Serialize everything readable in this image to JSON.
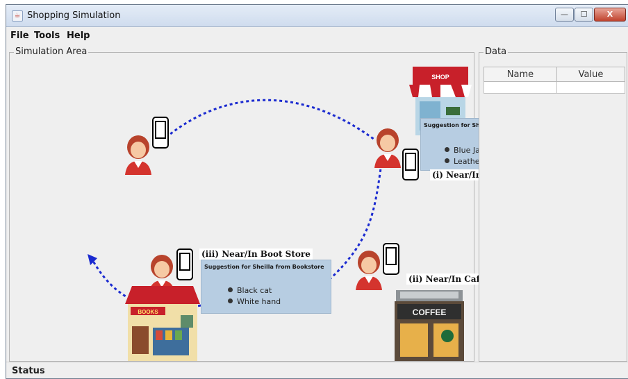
{
  "window": {
    "title": "Shopping Simulation",
    "controls": {
      "minimize": "—",
      "maximize": "☐",
      "close": "X"
    }
  },
  "menu": {
    "items": [
      "File",
      "Tools",
      "Help"
    ]
  },
  "simulation_panel": {
    "label": "Simulation Area",
    "shop_sign": "SHOP",
    "cafe_sign": "COFFEE",
    "bookstore_sign": "BOOKS",
    "locations": [
      {
        "label": "(i) Near/In Shop"
      },
      {
        "label": "(ii) Near/In Cafe"
      },
      {
        "label": "(iii) Near/In Boot Store"
      }
    ],
    "suggestions": [
      {
        "title": "Suggestion for Sheillafrom Fashion Shop",
        "items": [
          "Blue Jacket",
          "Leather Jacket"
        ]
      },
      {
        "title": "Suggestion for Sheilla from Bookstore",
        "items": [
          "Black cat",
          "White hand"
        ]
      }
    ]
  },
  "data_panel": {
    "label": "Data",
    "columns": [
      "Name",
      "Value"
    ]
  },
  "status": {
    "label": "Status"
  },
  "colors": {
    "path": "#1a2ad0",
    "bubble": "#b7cde2",
    "awning_red": "#c8202a"
  }
}
